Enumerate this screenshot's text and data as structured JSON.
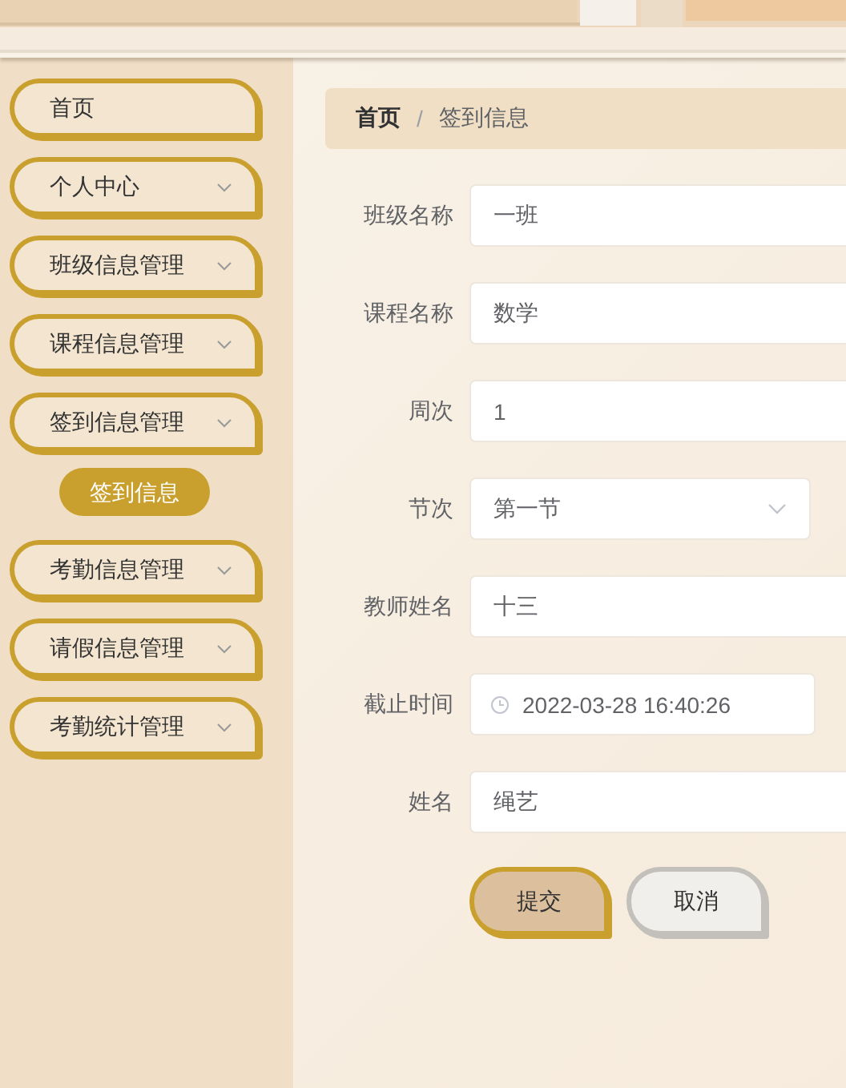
{
  "sidebar": {
    "items": [
      {
        "label": "首页",
        "has_arrow": false
      },
      {
        "label": "个人中心",
        "has_arrow": true
      },
      {
        "label": "班级信息管理",
        "has_arrow": true
      },
      {
        "label": "课程信息管理",
        "has_arrow": true
      },
      {
        "label": "签到信息管理",
        "has_arrow": true,
        "children": [
          {
            "label": "签到信息",
            "selected": true
          }
        ]
      },
      {
        "label": "考勤信息管理",
        "has_arrow": true
      },
      {
        "label": "请假信息管理",
        "has_arrow": true
      },
      {
        "label": "考勤统计管理",
        "has_arrow": true
      }
    ]
  },
  "breadcrumb": [
    "首页",
    "签到信息"
  ],
  "breadcrumb_separator": "/",
  "form": {
    "fields": [
      {
        "label": "班级名称",
        "kind": "text",
        "value": "一班"
      },
      {
        "label": "课程名称",
        "kind": "text",
        "value": "数学"
      },
      {
        "label": "周次",
        "kind": "text",
        "value": "1"
      },
      {
        "label": "节次",
        "kind": "select",
        "value": "第一节"
      },
      {
        "label": "教师姓名",
        "kind": "text",
        "value": "十三"
      },
      {
        "label": "截止时间",
        "kind": "datetime",
        "value": "2022-03-28 16:40:26"
      },
      {
        "label": "姓名",
        "kind": "text",
        "value": "绳艺"
      }
    ],
    "buttons": [
      {
        "label": "提交",
        "kind": "primary"
      },
      {
        "label": "取消",
        "kind": "secondary"
      }
    ]
  }
}
